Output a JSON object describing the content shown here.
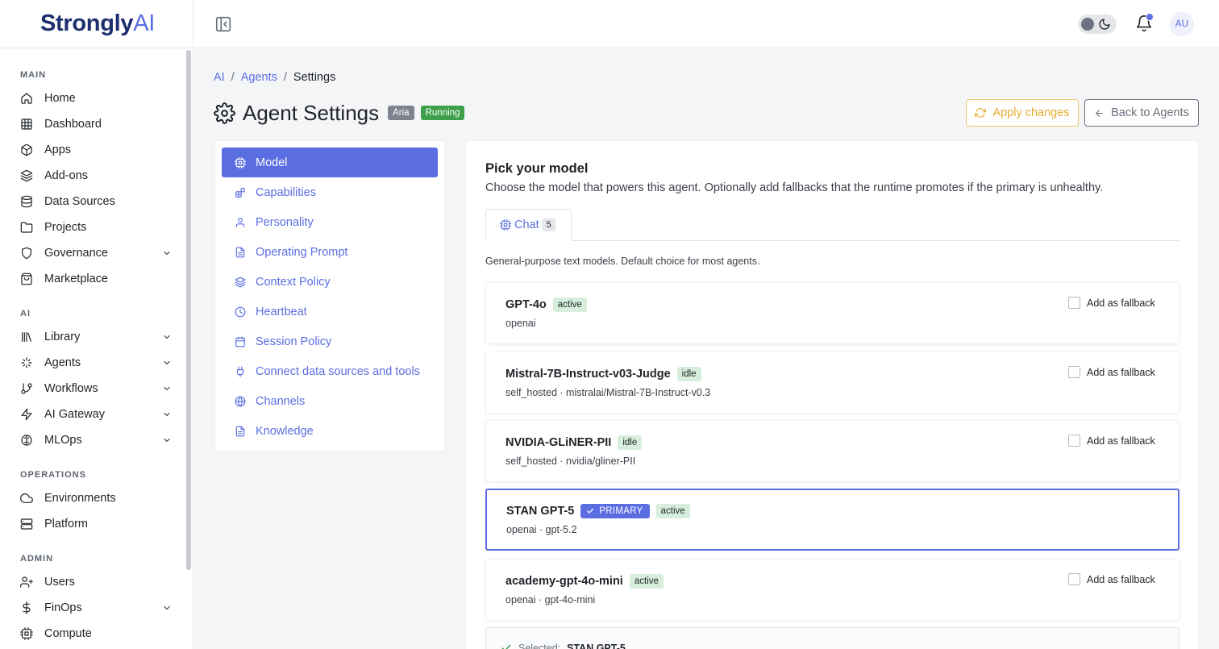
{
  "brand": {
    "main": "Strongly",
    "accent": "AI"
  },
  "sidebar": {
    "sections": [
      {
        "title": "MAIN",
        "items": [
          {
            "label": "Home",
            "icon": "home-icon"
          },
          {
            "label": "Dashboard",
            "icon": "grid-icon"
          },
          {
            "label": "Apps",
            "icon": "box-icon"
          },
          {
            "label": "Add-ons",
            "icon": "layers-icon"
          },
          {
            "label": "Data Sources",
            "icon": "database-icon"
          },
          {
            "label": "Projects",
            "icon": "folder-icon"
          },
          {
            "label": "Governance",
            "icon": "shield-icon",
            "expandable": true
          },
          {
            "label": "Marketplace",
            "icon": "shopping-bag-icon"
          }
        ]
      },
      {
        "title": "AI",
        "items": [
          {
            "label": "Library",
            "icon": "library-icon",
            "expandable": true
          },
          {
            "label": "Agents",
            "icon": "sparkles-icon",
            "expandable": true
          },
          {
            "label": "Workflows",
            "icon": "git-branch-icon",
            "expandable": true
          },
          {
            "label": "AI Gateway",
            "icon": "zap-icon",
            "expandable": true
          },
          {
            "label": "MLOps",
            "icon": "brain-icon",
            "expandable": true
          }
        ]
      },
      {
        "title": "OPERATIONS",
        "items": [
          {
            "label": "Environments",
            "icon": "cloud-icon"
          },
          {
            "label": "Platform",
            "icon": "server-icon"
          }
        ]
      },
      {
        "title": "ADMIN",
        "items": [
          {
            "label": "Users",
            "icon": "user-plus-icon"
          },
          {
            "label": "FinOps",
            "icon": "dollar-icon",
            "expandable": true
          },
          {
            "label": "Compute",
            "icon": "cpu-icon"
          }
        ]
      }
    ]
  },
  "header": {
    "avatar_initials": "AU"
  },
  "breadcrumb": {
    "items": [
      "AI",
      "Agents",
      "Settings"
    ],
    "separator": "/"
  },
  "page": {
    "title": "Agent Settings",
    "agent_badge": "Aria",
    "status_badge": "Running",
    "apply_label": "Apply changes",
    "back_label": "Back to Agents"
  },
  "settings_menu": [
    {
      "label": "Model",
      "icon": "cpu-icon",
      "active": true
    },
    {
      "label": "Capabilities",
      "icon": "blocks-icon"
    },
    {
      "label": "Personality",
      "icon": "user-icon"
    },
    {
      "label": "Operating Prompt",
      "icon": "file-text-icon"
    },
    {
      "label": "Context Policy",
      "icon": "layers-icon"
    },
    {
      "label": "Heartbeat",
      "icon": "clock-icon"
    },
    {
      "label": "Session Policy",
      "icon": "calendar-icon"
    },
    {
      "label": "Connect data sources and tools",
      "icon": "plug-icon"
    },
    {
      "label": "Channels",
      "icon": "globe-icon"
    },
    {
      "label": "Knowledge",
      "icon": "file-text-icon"
    }
  ],
  "model_panel": {
    "title": "Pick your model",
    "description": "Choose the model that powers this agent. Optionally add fallbacks that the runtime promotes if the primary is unhealthy.",
    "tab": {
      "label": "Chat",
      "count": "5"
    },
    "tab_description": "General-purpose text models. Default choice for most agents.",
    "fallback_label": "Add as fallback",
    "primary_label": "PRIMARY",
    "models": [
      {
        "name": "GPT-4o",
        "status": "active",
        "provider": "openai",
        "primary": false
      },
      {
        "name": "Mistral-7B-Instruct-v03-Judge",
        "status": "idle",
        "provider": "self_hosted · mistralai/Mistral-7B-Instruct-v0.3",
        "primary": false
      },
      {
        "name": "NVIDIA-GLiNER-PII",
        "status": "idle",
        "provider": "self_hosted · nvidia/gliner-PII",
        "primary": false
      },
      {
        "name": "STAN GPT-5",
        "status": "active",
        "provider": "openai · gpt-5.2",
        "primary": true
      },
      {
        "name": "academy-gpt-4o-mini",
        "status": "active",
        "provider": "openai · gpt-4o-mini",
        "primary": false
      }
    ],
    "selected_prefix": "Selected:",
    "selected_value": "STAN GPT-5"
  },
  "colors": {
    "accent": "#5b6ee1",
    "running": "#3d9f4a",
    "apply": "#e7ad2f",
    "status_bg": "#d6eedb"
  }
}
